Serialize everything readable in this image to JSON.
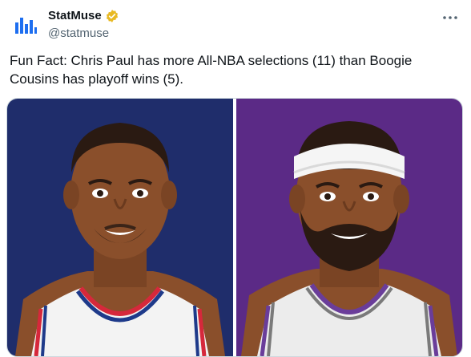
{
  "tweet": {
    "author": {
      "display_name": "StatMuse",
      "handle": "@statmuse",
      "verified_badge_icon": "gold-verified-badge-icon",
      "avatar_icon": "statmuse-logo-icon"
    },
    "more_icon": "more-options-icon",
    "text": "Fun Fact: Chris Paul has more All-NBA selections (11) than Boogie Cousins has playoff wins (5).",
    "media": [
      {
        "kind": "illustration",
        "background": "#1f2d6b",
        "jersey": "clippers-style white jersey with red and blue trim"
      },
      {
        "kind": "illustration",
        "background": "#5b2a86",
        "jersey": "kings-style white jersey with purple and grey trim"
      }
    ]
  },
  "colors": {
    "logo_blue": "#1d6ef0",
    "verified_gold": "#e8b923",
    "left_bg": "#1f2d6b",
    "right_bg": "#5b2a86",
    "skin": "#8a4f2b"
  }
}
